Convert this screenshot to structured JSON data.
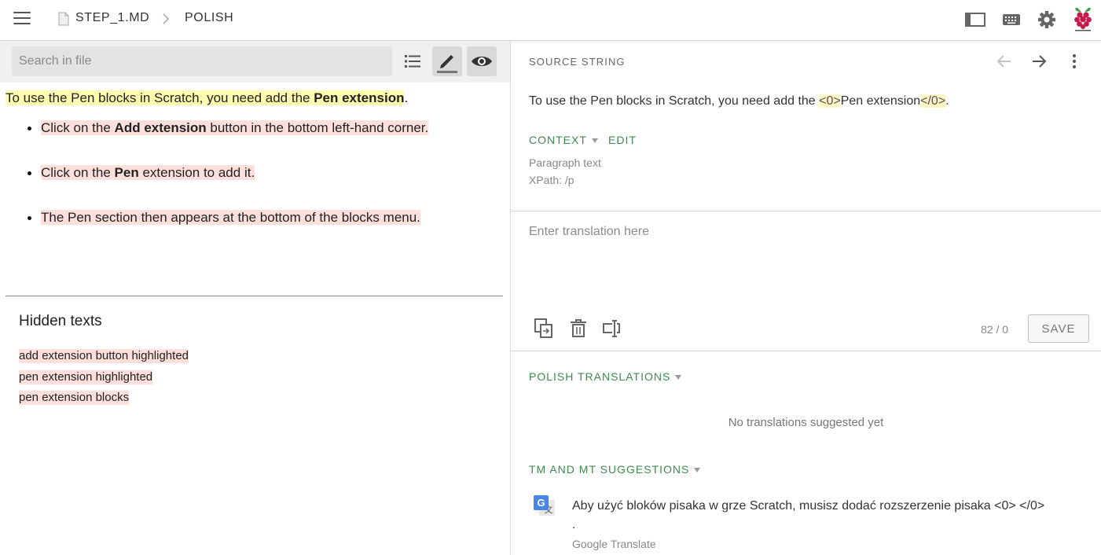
{
  "header": {
    "breadcrumb_file": "STEP_1.MD",
    "breadcrumb_language": "POLISH",
    "icons": [
      "menu-icon",
      "file-icon",
      "chevron-right-icon",
      "sidebar-toggle-icon",
      "keyboard-icon",
      "gear-icon",
      "raspberry-pi-logo"
    ]
  },
  "left": {
    "search_placeholder": "Search in file",
    "preview": {
      "intro": {
        "pre": "To use the Pen blocks in Scratch, you need add the ",
        "bold": "Pen extension",
        "post": "."
      },
      "bullets": [
        {
          "pre": "Click on the ",
          "bold": "Add extension",
          "post": " button in the bottom left-hand corner."
        },
        {
          "pre": "Click on the ",
          "bold": "Pen",
          "post": " extension to add it."
        },
        {
          "pre": "The Pen section then appears at the bottom of the blocks menu.",
          "bold": "",
          "post": ""
        }
      ]
    },
    "hidden_title": "Hidden texts",
    "hidden_items": [
      "add extension button highlighted",
      "pen extension highlighted",
      "pen extension blocks"
    ]
  },
  "right": {
    "source_label": "SOURCE STRING",
    "source": {
      "pre": "To use the Pen blocks in Scratch, you need add the ",
      "tag_open": "<0>",
      "mid": "Pen extension",
      "tag_close": "</0>",
      "post": "."
    },
    "context_label": "CONTEXT",
    "edit_label": "EDIT",
    "context_lines": [
      "Paragraph text",
      "XPath: /p"
    ],
    "translation_placeholder": "Enter translation here",
    "counter": "82 / 0",
    "save_label": "SAVE",
    "translations_label": "POLISH TRANSLATIONS",
    "no_translations": "No translations suggested yet",
    "suggestions_label": "TM AND MT SUGGESTIONS",
    "suggestion_text": "Aby użyć bloków pisaka w grze Scratch, musisz dodać rozszerzenie pisaka <0> </0> .",
    "suggestion_source": "Google Translate"
  },
  "colors": {
    "accent_green": "#3f8a4f",
    "highlight_yellow": "#fffcb0",
    "highlight_pink": "#fde0dc",
    "raspberry": "#c51a4a"
  }
}
